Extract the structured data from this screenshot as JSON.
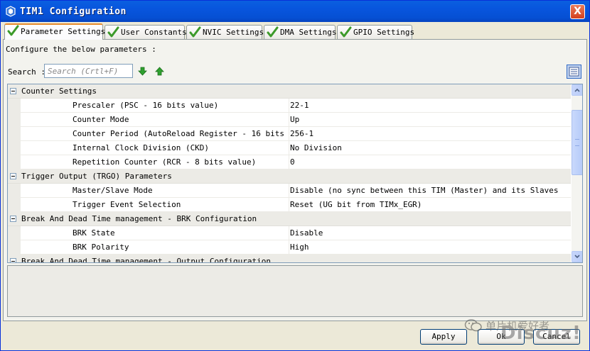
{
  "window": {
    "title": "TIM1 Configuration",
    "close_label": "X"
  },
  "tabs": [
    {
      "label": "Parameter Settings",
      "active": true
    },
    {
      "label": "User Constants",
      "active": false
    },
    {
      "label": "NVIC Settings",
      "active": false
    },
    {
      "label": "DMA Settings",
      "active": false
    },
    {
      "label": "GPIO Settings",
      "active": false
    }
  ],
  "description": "Configure the below parameters :",
  "search": {
    "label": "Search :",
    "placeholder": "Search (Crtl+F)"
  },
  "groups": [
    {
      "label": "Counter Settings",
      "params": [
        {
          "name": "Prescaler (PSC - 16 bits value)",
          "value": "22-1"
        },
        {
          "name": "Counter Mode",
          "value": "Up"
        },
        {
          "name": "Counter Period (AutoReload Register - 16 bits v...",
          "value": "256-1"
        },
        {
          "name": "Internal Clock Division (CKD)",
          "value": "No Division"
        },
        {
          "name": "Repetition Counter (RCR - 8 bits value)",
          "value": "0"
        }
      ]
    },
    {
      "label": "Trigger Output (TRGO) Parameters",
      "params": [
        {
          "name": "Master/Slave Mode",
          "value": "Disable (no sync between this TIM (Master) and its Slaves"
        },
        {
          "name": "Trigger Event Selection",
          "value": "Reset (UG bit from TIMx_EGR)"
        }
      ]
    },
    {
      "label": "Break And Dead Time management - BRK Configuration",
      "params": [
        {
          "name": "BRK State",
          "value": "Disable"
        },
        {
          "name": "BRK Polarity",
          "value": "High"
        }
      ]
    },
    {
      "label": "Break And Dead Time management - Output Configuration",
      "params": []
    }
  ],
  "buttons": {
    "apply": "Apply",
    "ok": "Ok",
    "cancel": "Cancel"
  },
  "watermark": {
    "text": "单片机爱好者",
    "brand": "Discuz!"
  },
  "colors": {
    "titlebar": "#0855dd",
    "active_tab_accent": "#e68b2c",
    "check_green": "#3c9a2a"
  }
}
